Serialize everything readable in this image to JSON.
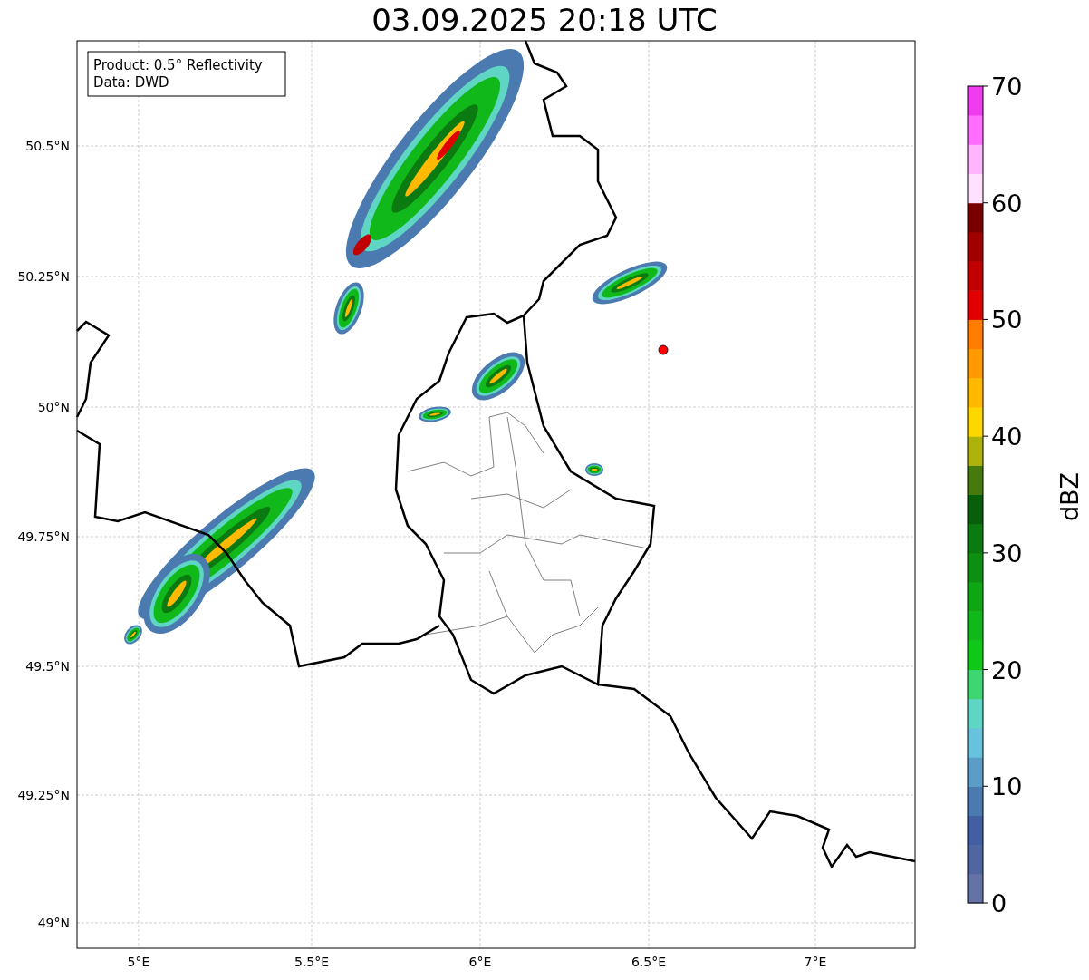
{
  "title": "03.09.2025 20:18 UTC",
  "info_box": {
    "lines": [
      "Product: 0.5° Reflectivity",
      "Data: DWD"
    ]
  },
  "y_ticks": [
    "50.5°N",
    "50.25°N",
    "50°N",
    "49.75°N",
    "49.5°N",
    "49.25°N",
    "49°N"
  ],
  "x_ticks": [
    "5°E",
    "5.5°E",
    "6°E",
    "6.5°E",
    "7°E"
  ],
  "colorbar": {
    "label": "dBZ",
    "ticks": [
      "70",
      "60",
      "50",
      "40",
      "30",
      "20",
      "10",
      "0"
    ],
    "bins": [
      {
        "color": "#6472a6"
      },
      {
        "color": "#5066a0"
      },
      {
        "color": "#435fa3"
      },
      {
        "color": "#4a7ab0"
      },
      {
        "color": "#5a9dc7"
      },
      {
        "color": "#68c2dd"
      },
      {
        "color": "#5fd6c4"
      },
      {
        "color": "#3dd672"
      },
      {
        "color": "#11c81a"
      },
      {
        "color": "#10b81a"
      },
      {
        "color": "#0ea614"
      },
      {
        "color": "#0f8f12"
      },
      {
        "color": "#0b7a10"
      },
      {
        "color": "#075f0b"
      },
      {
        "color": "#467a0f"
      },
      {
        "color": "#adb30a"
      },
      {
        "color": "#ffd700"
      },
      {
        "color": "#ffb900"
      },
      {
        "color": "#ff9b00"
      },
      {
        "color": "#ff7d00"
      },
      {
        "color": "#e00000"
      },
      {
        "color": "#c00000"
      },
      {
        "color": "#a00000"
      },
      {
        "color": "#780000"
      },
      {
        "color": "#ffe0ff"
      },
      {
        "color": "#ffb4ff"
      },
      {
        "color": "#ff6eff"
      },
      {
        "color": "#ee3cee"
      }
    ]
  }
}
